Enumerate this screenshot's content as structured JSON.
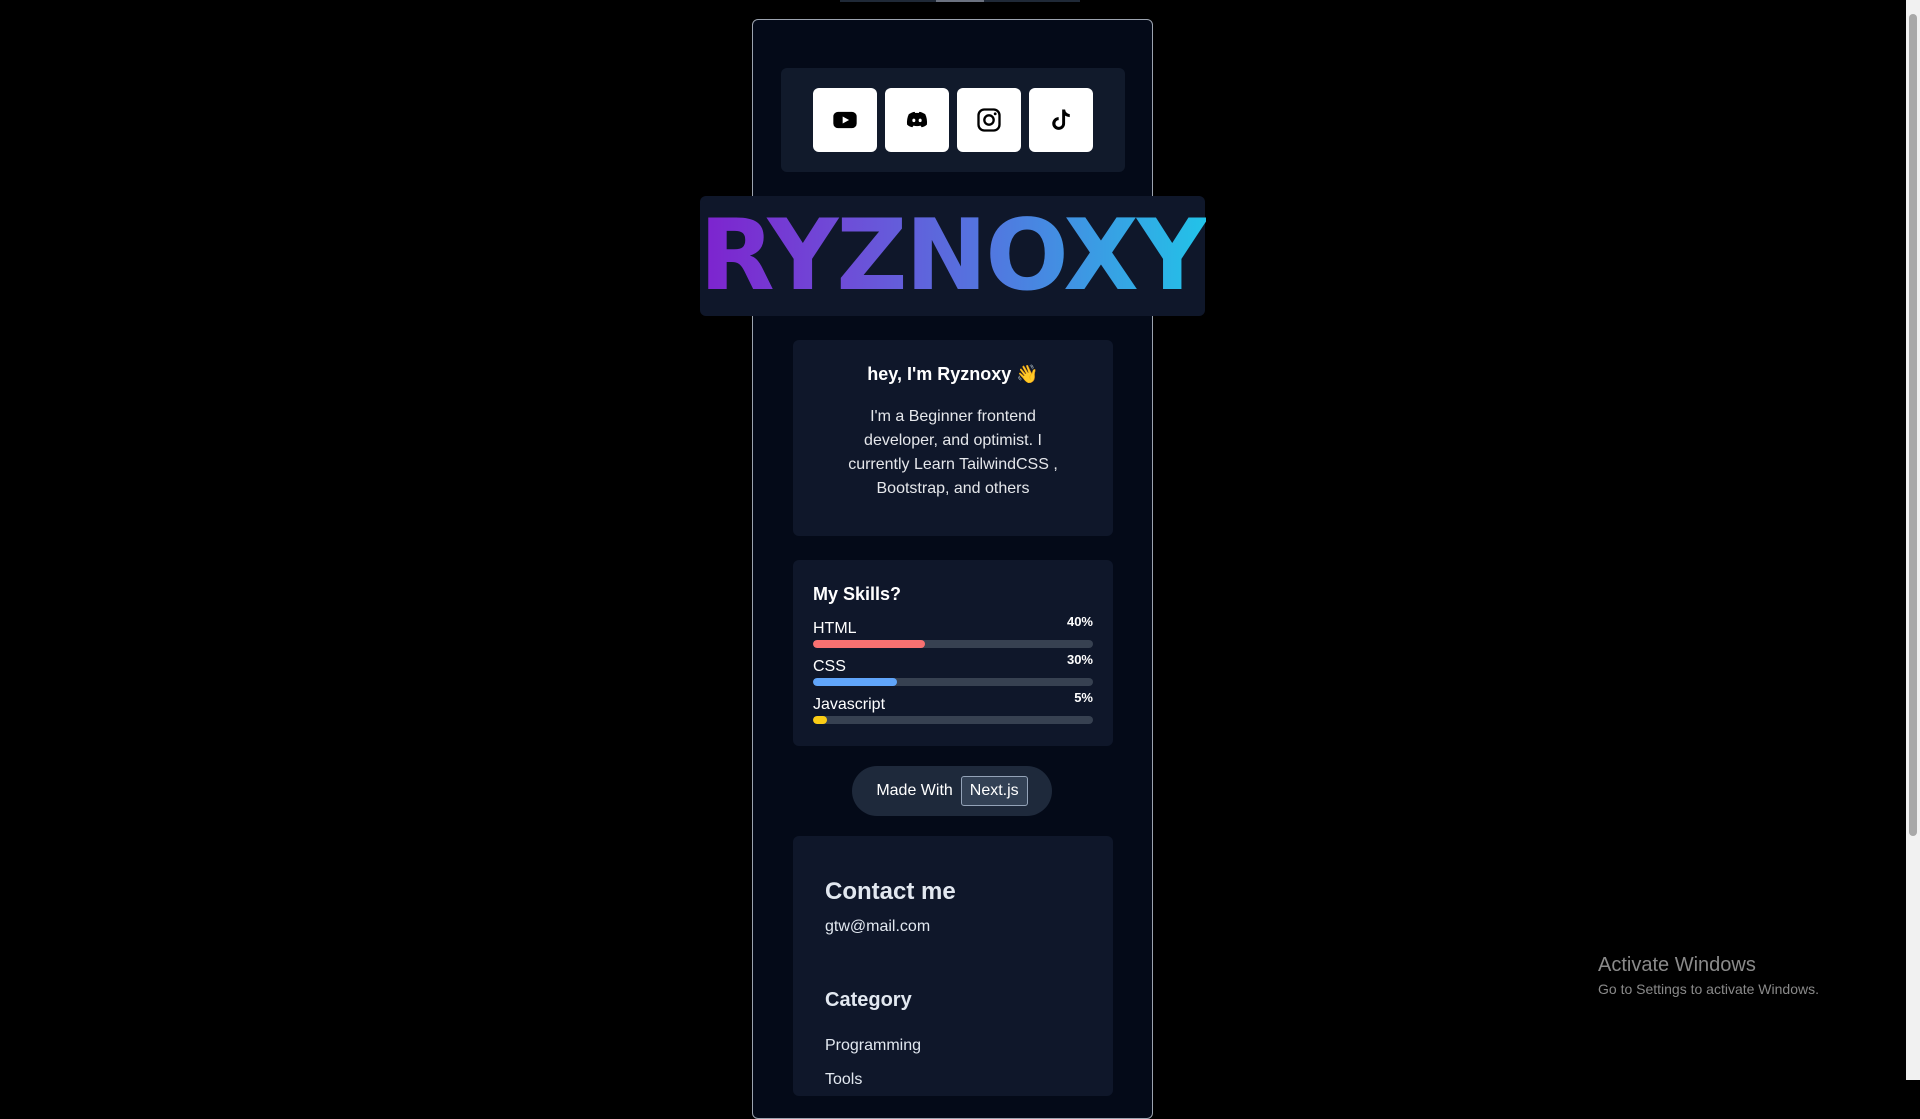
{
  "social": {
    "links": [
      {
        "name": "youtube",
        "icon": "youtube-icon"
      },
      {
        "name": "discord",
        "icon": "discord-icon"
      },
      {
        "name": "instagram",
        "icon": "instagram-icon"
      },
      {
        "name": "tiktok",
        "icon": "tiktok-icon"
      }
    ]
  },
  "brand": {
    "name": "RYZNOXY",
    "gradient": [
      "#7e22ce",
      "#22c3e8"
    ]
  },
  "intro": {
    "title": "hey, I'm Ryznoxy 👋",
    "body": "I'm a Beginner frontend developer, and optimist. I currently Learn TailwindCSS , Bootstrap, and others"
  },
  "skills": {
    "title": "My Skills?",
    "items": [
      {
        "name": "HTML",
        "percent_label": "40%",
        "percent": 40,
        "color": "#f87171"
      },
      {
        "name": "CSS",
        "percent_label": "30%",
        "percent": 30,
        "color": "#60a5fa"
      },
      {
        "name": "Javascript",
        "percent_label": "5%",
        "percent": 5,
        "color": "#facc15"
      }
    ]
  },
  "made_with": {
    "label": "Made With",
    "tech": "Next.js"
  },
  "contact": {
    "title": "Contact me",
    "email": "gtw@mail.com"
  },
  "category": {
    "title": "Category",
    "items": [
      "Programming",
      "Tools"
    ]
  },
  "os_watermark": {
    "line1": "Activate Windows",
    "line2": "Go to Settings to activate Windows."
  }
}
